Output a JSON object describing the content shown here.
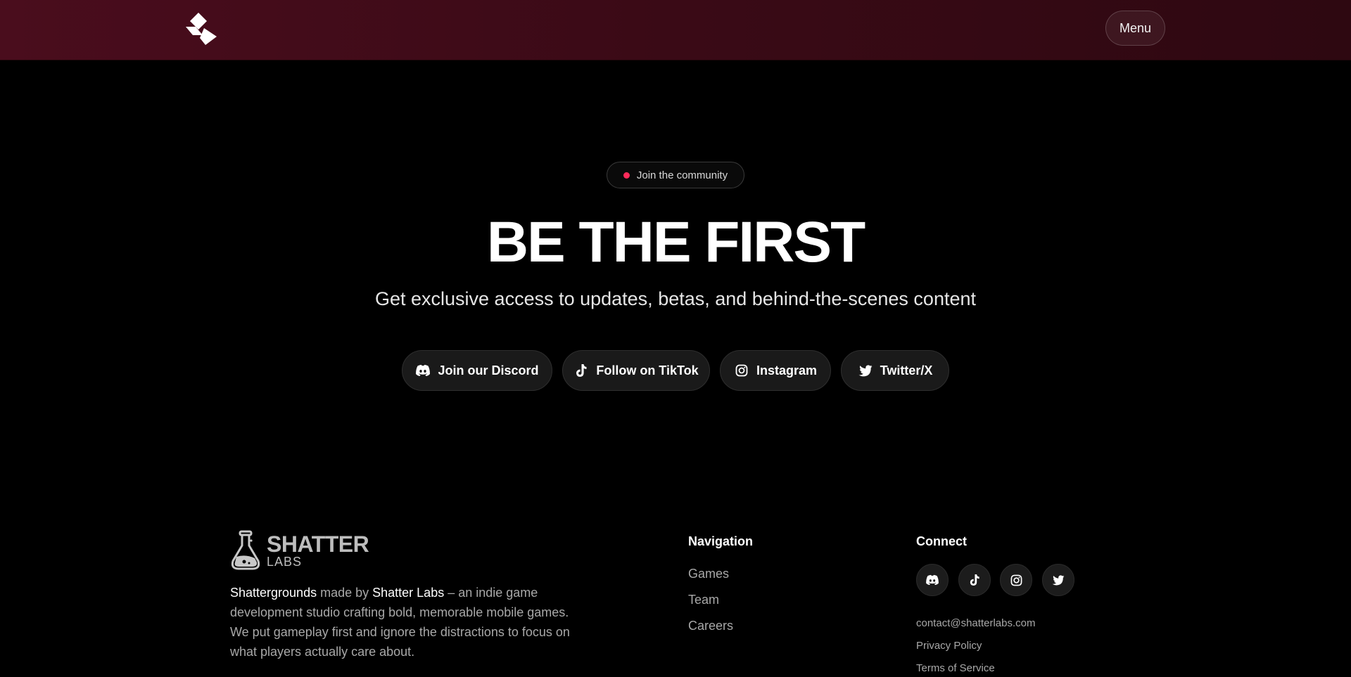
{
  "header": {
    "menu_label": "Menu"
  },
  "hero": {
    "pill_label": "Join the community",
    "title": "BE THE FIRST",
    "subtitle": "Get exclusive access to updates, betas, and behind-the-scenes content",
    "buttons": [
      {
        "label": "Join our Discord",
        "icon": "discord-icon"
      },
      {
        "label": "Follow on TikTok",
        "icon": "tiktok-icon"
      },
      {
        "label": "Instagram",
        "icon": "instagram-icon"
      },
      {
        "label": "Twitter/X",
        "icon": "twitter-icon"
      }
    ]
  },
  "footer": {
    "brand": {
      "word": "SHATTER",
      "sub": "LABS"
    },
    "about": {
      "game_name": "Shattergrounds",
      "made_by": " made by ",
      "studio_name": "Shatter Labs",
      "text": " – an indie game development studio crafting bold, memorable mobile games. We put gameplay first and ignore the distractions to focus on what players actually care about."
    },
    "navigation": {
      "title": "Navigation",
      "links": [
        "Games",
        "Team",
        "Careers"
      ]
    },
    "connect": {
      "title": "Connect",
      "icons": [
        "discord-icon",
        "tiktok-icon",
        "instagram-icon",
        "twitter-icon"
      ],
      "email": "contact@shatterlabs.com",
      "privacy": "Privacy Policy",
      "terms": "Terms of Service"
    }
  },
  "colors": {
    "header_bg": "#4a0d1d",
    "accent_dot": "#ff2b5a",
    "button_bg": "#1a1a1a"
  }
}
